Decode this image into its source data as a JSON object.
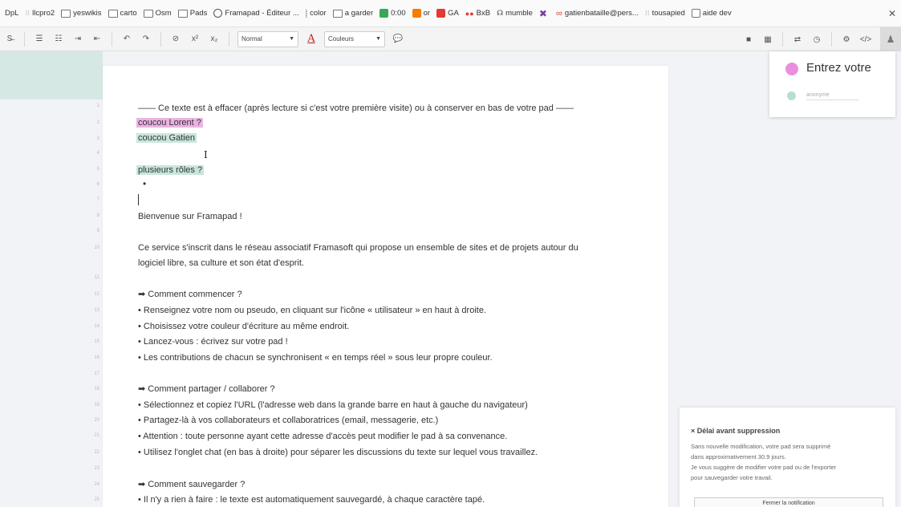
{
  "bookmarks": [
    {
      "label": "DpL",
      "icon": "none"
    },
    {
      "label": "llcpro2",
      "icon": "bookmark-icon"
    },
    {
      "label": "yeswikis",
      "icon": "folder-icon"
    },
    {
      "label": "carto",
      "icon": "folder-icon"
    },
    {
      "label": "Osm",
      "icon": "folder-icon"
    },
    {
      "label": "Pads",
      "icon": "folder-icon"
    },
    {
      "label": "Framapad - Éditeur ...",
      "icon": "globe-icon"
    },
    {
      "label": "color",
      "icon": "color-icon"
    },
    {
      "label": "a garder",
      "icon": "folder-icon"
    },
    {
      "label": "0:00",
      "icon": "timer-icon",
      "color": "#3aa757"
    },
    {
      "label": "or",
      "icon": "or-icon",
      "color": "#f57c00"
    },
    {
      "label": "GA",
      "icon": "ga-icon",
      "color": "#e53935"
    },
    {
      "label": "BxB",
      "icon": "bxb-icon",
      "color": "#e53935"
    },
    {
      "label": "mumble",
      "icon": "mumble-icon"
    },
    {
      "label": "",
      "icon": "cross-icon",
      "color": "#7b3fa0"
    },
    {
      "label": "gatienbataille@pers...",
      "icon": "infinity-icon",
      "color": "#e53935"
    },
    {
      "label": "tousapied",
      "icon": "bookmark-icon"
    },
    {
      "label": "aide dev",
      "icon": "search-icon"
    }
  ],
  "toolbar": {
    "style_select": "Normal",
    "color_label": "Couleurs",
    "superscript": "x²",
    "subscript": "x₂"
  },
  "users": {
    "name_placeholder": "Entrez votre",
    "anonymous": "anonyme",
    "my_color": "#ea8fde",
    "other_color": "#b7dfcf"
  },
  "editor": {
    "line_numbers": [
      "1",
      "2",
      "3",
      "4",
      "5",
      "6",
      "7",
      "8",
      "9",
      "10",
      "11",
      "12",
      "13",
      "14",
      "15",
      "16",
      "17",
      "18",
      "19",
      "20",
      "21",
      "22",
      "23",
      "24",
      "25"
    ],
    "lines": {
      "l1": "—— Ce texte est à effacer (après lecture si c'est votre première visite) ou à conserver en bas de votre pad ——",
      "l2": "coucou Lorent ?",
      "l3": "coucou Gatien",
      "l5": "plusieurs rôles ?",
      "l6": "•",
      "l8": "Bienvenue sur Framapad !",
      "l10a": "Ce service s'inscrit dans le réseau associatif Framasoft qui propose un ensemble de sites et de projets autour du",
      "l10b": "logiciel libre, sa culture et son état d'esprit.",
      "l12": "➡ Comment commencer ?",
      "l13": "• Renseignez votre nom ou pseudo, en cliquant sur l'icône « utilisateur » en haut à droite.",
      "l14": "• Choisissez votre couleur d'écriture au même endroit.",
      "l15": "• Lancez-vous : écrivez sur votre pad !",
      "l16": "• Les contributions de chacun se synchronisent « en temps réel » sous leur propre couleur.",
      "l18": "➡ Comment partager / collaborer ?",
      "l19": "• Sélectionnez et copiez l'URL (l'adresse web dans la grande barre en haut à gauche du navigateur)",
      "l20": "• Partagez-là à vos collaborateurs et collaboratrices (email, messagerie, etc.)",
      "l21": "• Attention : toute personne ayant cette adresse d'accès peut modifier le pad à sa convenance.",
      "l22": "• Utilisez l'onglet chat (en bas à droite) pour séparer les discussions du texte sur lequel vous travaillez.",
      "l24": "➡ Comment sauvegarder ?",
      "l25": "• Il n'y a rien à faire : le texte est automatiquement sauvegardé, à chaque caractère tapé."
    },
    "highlight_pink": "#eab3e3",
    "highlight_teal": "#c8e6dc"
  },
  "notification": {
    "title": "× Délai avant suppression",
    "line1": "Sans nouvelle modification, votre pad sera supprimé",
    "line2": "dans approximativement 30.9 jours.",
    "line3": "Je vous suggère de modifier votre pad ou de l'exporter",
    "line4": "pour sauvegarder votre travail.",
    "button": "Fermer la notification"
  }
}
